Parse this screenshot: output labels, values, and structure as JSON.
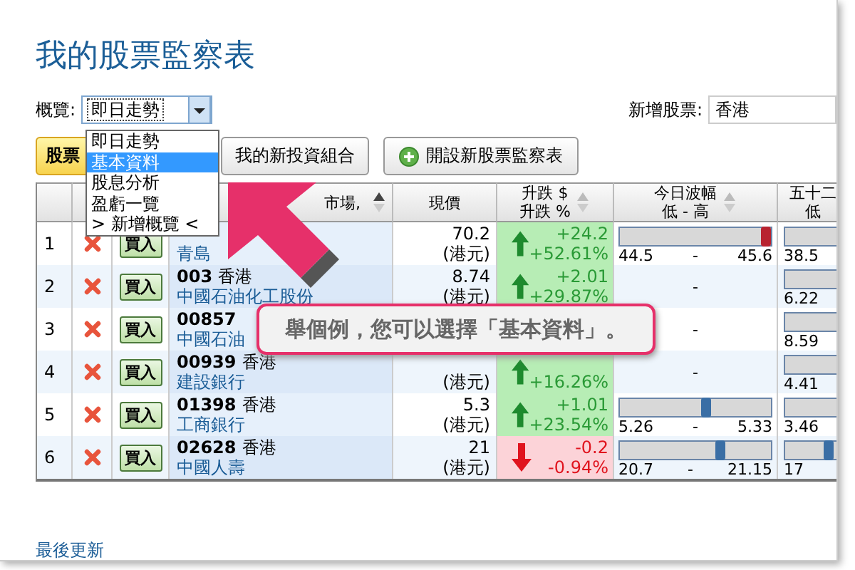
{
  "title": "我的股票監察表",
  "overview": {
    "label": "概覽:",
    "value": "即日走勢"
  },
  "add_stock": {
    "label": "新增股票:",
    "value": "香港"
  },
  "overview_menu": [
    {
      "label": "即日走勢",
      "selected": false
    },
    {
      "label": "基本資料",
      "selected": true
    },
    {
      "label": "股息分析",
      "selected": false
    },
    {
      "label": "盈虧一覽",
      "selected": false
    },
    {
      "label": "> 新增概覽 <",
      "selected": false
    }
  ],
  "buttons": [
    {
      "label": "股票",
      "kind": "tab"
    },
    {
      "label": "我的新投資組合",
      "kind": "plain"
    },
    {
      "label": "開設新股票監察表",
      "kind": "add"
    }
  ],
  "table": {
    "columns": [
      {
        "lines": [
          "市場,"
        ],
        "sortable": true
      },
      {
        "lines": [
          "現價"
        ],
        "sortable": false
      },
      {
        "lines": [
          "升跌 $",
          "升跌 %"
        ],
        "sortable": true
      },
      {
        "lines": [
          "今日波幅",
          "低 - 高"
        ],
        "sortable": true
      },
      {
        "lines": [
          "五十二",
          "低"
        ]
      }
    ],
    "rows": [
      {
        "index": "1",
        "buy": "買入",
        "name": "青島",
        "price": "70.2",
        "currency": "(港元)",
        "change": "+24.2",
        "change_pct": "+52.61%",
        "rising": true,
        "range": {
          "low": "44.5",
          "sep": "-",
          "high": "45.6",
          "level": 0.97,
          "color": "#b8232f"
        },
        "week52": {
          "low": "38.5"
        }
      },
      {
        "index": "2",
        "buy": "買入",
        "code": "003",
        "market": "香港",
        "name": "中國石油化工股份",
        "price": "8.74",
        "currency": "(港元)",
        "change": "+2.01",
        "change_pct": "+29.87%",
        "rising": true,
        "range": {
          "sep": "-"
        },
        "week52": {
          "low": "6.22"
        }
      },
      {
        "index": "3",
        "buy": "買入",
        "code": "00857",
        "name": "中國石油",
        "range": {
          "sep": "-"
        },
        "week52": {
          "low": "8.59"
        }
      },
      {
        "index": "4",
        "buy": "買入",
        "code": "00939",
        "market": "香港",
        "name": "建設銀行",
        "currency": "(港元)",
        "change_pct": "+16.26%",
        "rising": true,
        "range": {
          "sep": "-"
        },
        "week52": {
          "low": "4.41"
        }
      },
      {
        "index": "5",
        "buy": "買入",
        "code": "01398",
        "market": "香港",
        "name": "工商銀行",
        "price": "5.3",
        "currency": "(港元)",
        "change": "+1.01",
        "change_pct": "+23.54%",
        "rising": true,
        "range": {
          "low": "5.26",
          "sep": "-",
          "high": "5.33",
          "level": 0.58,
          "color": "#3a6ea5"
        },
        "week52": {
          "low": "3.46"
        }
      },
      {
        "index": "6",
        "buy": "買入",
        "code": "02628",
        "market": "香港",
        "name": "中國人壽",
        "price": "21",
        "currency": "(港元)",
        "change": "-0.2",
        "change_pct": "-0.94%",
        "rising": false,
        "range": {
          "low": "20.7",
          "sep": "-",
          "high": "21.15",
          "level": 0.67,
          "color": "#3a6ea5"
        },
        "week52": {
          "low": "17",
          "level": 0.85
        }
      }
    ]
  },
  "callout": "舉個例，您可以選擇「基本資料」。",
  "footer_link": "最後更新"
}
